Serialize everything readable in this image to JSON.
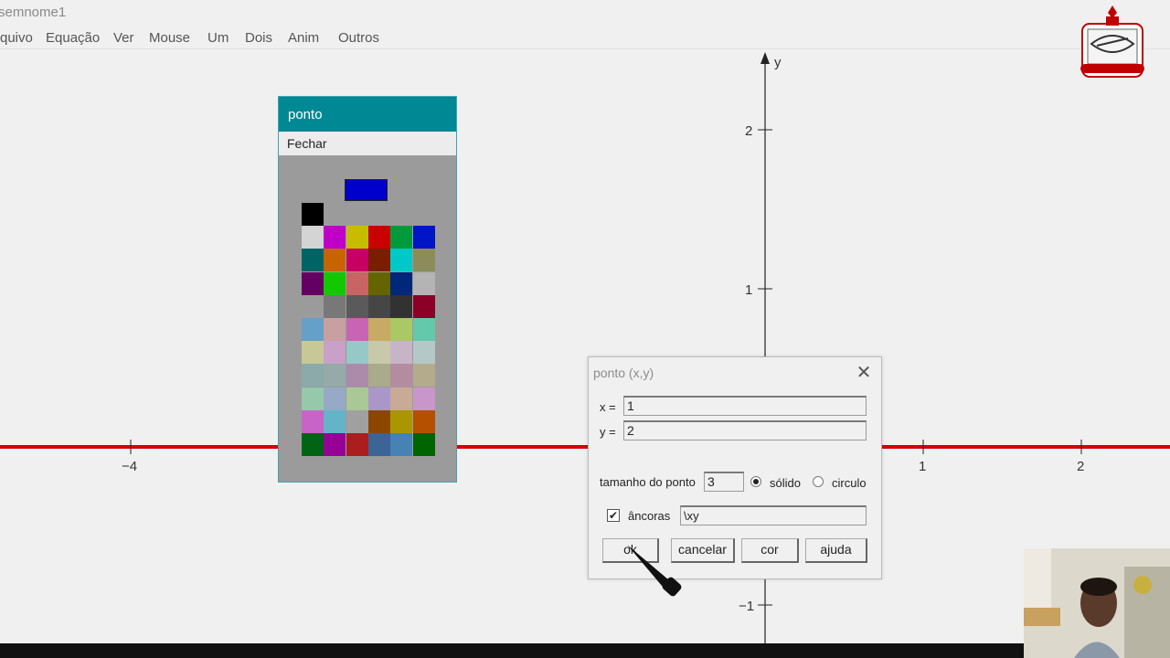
{
  "app": {
    "title": "semnome1"
  },
  "menubar": {
    "items": [
      "quivo",
      "Equação",
      "Ver",
      "Mouse",
      "Um",
      "Dois",
      "Anim",
      "Outros"
    ]
  },
  "graph": {
    "y_axis_label": "y",
    "x_ticks": [
      "−4",
      "1",
      "2"
    ],
    "y_ticks": [
      "2",
      "1",
      "−1"
    ],
    "line_color": "#d40000"
  },
  "palette": {
    "title": "ponto",
    "close_label": "Fechar",
    "current_color": "#0000cc",
    "colors": [
      [
        "#000000"
      ],
      [
        "#d4d4d4",
        "#c000c8",
        "#c8bc00",
        "#c80000",
        "#009a3a",
        "#0014c8"
      ],
      [
        "#006464",
        "#c86400",
        "#c80064",
        "#7a1e00",
        "#00c8c8",
        "#8c8c5a"
      ],
      [
        "#640064",
        "#14c800",
        "#c86464",
        "#646400",
        "#00287a",
        "#b4b4b4"
      ],
      [
        null,
        "#787878",
        "#5a5a5a",
        "#464646",
        "#323232",
        "#8c0028"
      ],
      [
        "#64a0c8",
        "#c8a0a0",
        "#c864b4",
        "#c8aa64",
        "#aac864",
        "#64c8aa"
      ],
      [
        "#c8c896",
        "#c8a0c8",
        "#96c8c8",
        "#c8c8aa",
        "#c8b4c8",
        "#b4c8c8"
      ],
      [
        "#8caaaa",
        "#96aaaa",
        "#aa8caa",
        "#aaaa8c",
        "#b48ca0",
        "#b4aa8c"
      ],
      [
        "#96c8aa",
        "#96aac8",
        "#aac896",
        "#aa96c8",
        "#c8aa96",
        "#c896c8"
      ],
      [
        "#c864c8",
        "#64b4c8",
        "#a0a0a0",
        "#8c4600",
        "#aa9600",
        "#b45000"
      ],
      [
        "#006414",
        "#960096",
        "#aa1e1e",
        "#3c6496",
        "#4682b4",
        "#006400"
      ]
    ]
  },
  "dialog": {
    "title": "ponto (x,y)",
    "x_label": "x =",
    "x_value": "1",
    "y_label": "y =",
    "y_value": "2",
    "size_label": "tamanho do ponto",
    "size_value": "3",
    "solid_label": "sólido",
    "circle_label": "circulo",
    "anchors_label": "âncoras",
    "anchors_value": "\\xy",
    "buttons": {
      "ok": "ok",
      "cancel": "cancelar",
      "color": "cor",
      "help": "ajuda"
    }
  }
}
